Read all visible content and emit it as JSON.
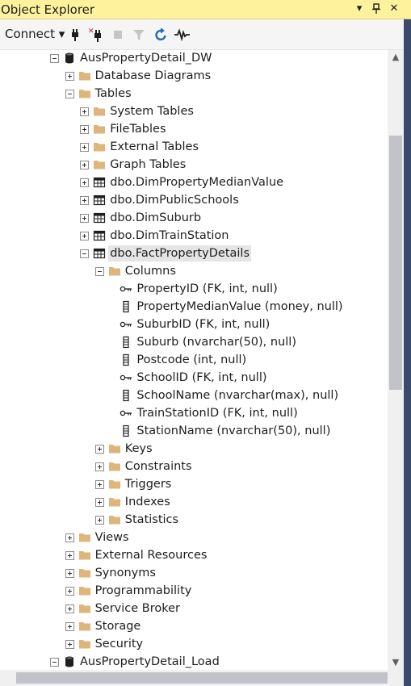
{
  "window": {
    "title": "Object Explorer",
    "dropdown_glyph": "▾",
    "pin_glyph": "📌",
    "close_glyph": "✕"
  },
  "toolbar": {
    "connect_label": "Connect ▾",
    "tools": [
      "connect-plug-icon",
      "disconnect-icon",
      "stop-icon",
      "filter-icon",
      "refresh-icon",
      "activity-monitor-icon"
    ]
  },
  "colors": {
    "title_bar": "#fff29d",
    "folder": "#dcb67a",
    "selected": "#e5e5e5",
    "refresh": "#1e6bb8"
  },
  "tree": [
    {
      "label": "AusPropertyDetail_DW",
      "indent": 0,
      "icon": "database-icon",
      "expander": "minus"
    },
    {
      "label": "Database Diagrams",
      "indent": 1,
      "icon": "folder-icon",
      "expander": "plus"
    },
    {
      "label": "Tables",
      "indent": 1,
      "icon": "folder-icon",
      "expander": "minus"
    },
    {
      "label": "System Tables",
      "indent": 2,
      "icon": "folder-icon",
      "expander": "plus"
    },
    {
      "label": "FileTables",
      "indent": 2,
      "icon": "folder-icon",
      "expander": "plus"
    },
    {
      "label": "External Tables",
      "indent": 2,
      "icon": "folder-icon",
      "expander": "plus"
    },
    {
      "label": "Graph Tables",
      "indent": 2,
      "icon": "folder-icon",
      "expander": "plus"
    },
    {
      "label": "dbo.DimPropertyMedianValue",
      "indent": 2,
      "icon": "table-icon",
      "expander": "plus"
    },
    {
      "label": "dbo.DimPublicSchools",
      "indent": 2,
      "icon": "table-icon",
      "expander": "plus"
    },
    {
      "label": "dbo.DimSuburb",
      "indent": 2,
      "icon": "table-icon",
      "expander": "plus"
    },
    {
      "label": "dbo.DimTrainStation",
      "indent": 2,
      "icon": "table-icon",
      "expander": "plus"
    },
    {
      "label": "dbo.FactPropertyDetails",
      "indent": 2,
      "icon": "table-icon",
      "expander": "minus",
      "selected": true
    },
    {
      "label": "Columns",
      "indent": 3,
      "icon": "folder-icon",
      "expander": "minus"
    },
    {
      "label": "PropertyID (FK, int, null)",
      "indent": 4,
      "icon": "key-icon",
      "expander": "none"
    },
    {
      "label": "PropertyMedianValue (money, null)",
      "indent": 4,
      "icon": "column-icon",
      "expander": "none"
    },
    {
      "label": "SuburbID (FK, int, null)",
      "indent": 4,
      "icon": "key-icon",
      "expander": "none"
    },
    {
      "label": "Suburb (nvarchar(50), null)",
      "indent": 4,
      "icon": "column-icon",
      "expander": "none"
    },
    {
      "label": "Postcode (int, null)",
      "indent": 4,
      "icon": "column-icon",
      "expander": "none"
    },
    {
      "label": "SchoolID (FK, int, null)",
      "indent": 4,
      "icon": "key-icon",
      "expander": "none"
    },
    {
      "label": "SchoolName (nvarchar(max), null)",
      "indent": 4,
      "icon": "column-icon",
      "expander": "none"
    },
    {
      "label": "TrainStationID (FK, int, null)",
      "indent": 4,
      "icon": "key-icon",
      "expander": "none"
    },
    {
      "label": "StationName (nvarchar(50), null)",
      "indent": 4,
      "icon": "column-icon",
      "expander": "none"
    },
    {
      "label": "Keys",
      "indent": 3,
      "icon": "folder-icon",
      "expander": "plus"
    },
    {
      "label": "Constraints",
      "indent": 3,
      "icon": "folder-icon",
      "expander": "plus"
    },
    {
      "label": "Triggers",
      "indent": 3,
      "icon": "folder-icon",
      "expander": "plus"
    },
    {
      "label": "Indexes",
      "indent": 3,
      "icon": "folder-icon",
      "expander": "plus"
    },
    {
      "label": "Statistics",
      "indent": 3,
      "icon": "folder-icon",
      "expander": "plus"
    },
    {
      "label": "Views",
      "indent": 1,
      "icon": "folder-icon",
      "expander": "plus"
    },
    {
      "label": "External Resources",
      "indent": 1,
      "icon": "folder-icon",
      "expander": "plus"
    },
    {
      "label": "Synonyms",
      "indent": 1,
      "icon": "folder-icon",
      "expander": "plus"
    },
    {
      "label": "Programmability",
      "indent": 1,
      "icon": "folder-icon",
      "expander": "plus"
    },
    {
      "label": "Service Broker",
      "indent": 1,
      "icon": "folder-icon",
      "expander": "plus"
    },
    {
      "label": "Storage",
      "indent": 1,
      "icon": "folder-icon",
      "expander": "plus"
    },
    {
      "label": "Security",
      "indent": 1,
      "icon": "folder-icon",
      "expander": "plus"
    },
    {
      "label": "AusPropertyDetail_Load",
      "indent": 0,
      "icon": "database-icon",
      "expander": "minus"
    }
  ],
  "scrollbar": {
    "up_glyph": "▲",
    "down_glyph": "▼",
    "thumb_start": 0.12,
    "thumb_size": 0.43
  }
}
